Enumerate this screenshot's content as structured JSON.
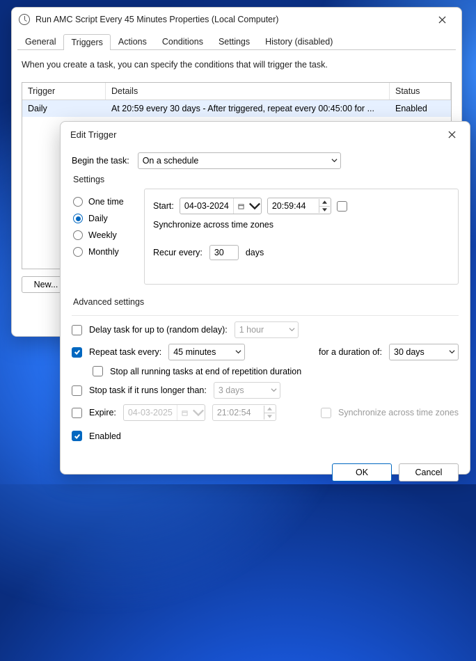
{
  "props": {
    "title": "Run AMC Script Every 45 Minutes Properties (Local Computer)",
    "tabs": [
      "General",
      "Triggers",
      "Actions",
      "Conditions",
      "Settings",
      "History (disabled)"
    ],
    "active_tab": 1,
    "desc": "When you create a task, you can specify the conditions that will trigger the task.",
    "cols": {
      "trigger": "Trigger",
      "details": "Details",
      "status": "Status"
    },
    "row": {
      "trigger": "Daily",
      "details": "At 20:59 every 30 days - After triggered, repeat every 00:45:00 for ...",
      "status": "Enabled"
    },
    "buttons": {
      "new": "New..."
    }
  },
  "edit": {
    "title": "Edit Trigger",
    "begin_label": "Begin the task:",
    "begin_value": "On a schedule",
    "settings_label": "Settings",
    "radios": {
      "onetime": "One time",
      "daily": "Daily",
      "weekly": "Weekly",
      "monthly": "Monthly"
    },
    "start_label": "Start:",
    "start_date": "04-03-2024",
    "start_time": "20:59:44",
    "sync_tz": "Synchronize across time zones",
    "recur_label": "Recur every:",
    "recur_value": "30",
    "recur_unit": "days",
    "adv_label": "Advanced settings",
    "delay_label": "Delay task for up to (random delay):",
    "delay_value": "1 hour",
    "repeat_label": "Repeat task every:",
    "repeat_value": "45 minutes",
    "duration_label": "for a duration of:",
    "duration_value": "30 days",
    "stopall_label": "Stop all running tasks at end of repetition duration",
    "stoplong_label": "Stop task if it runs longer than:",
    "stoplong_value": "3 days",
    "expire_label": "Expire:",
    "expire_date": "04-03-2025",
    "expire_time": "21:02:54",
    "sync_tz2": "Synchronize across time zones",
    "enabled_label": "Enabled",
    "ok": "OK",
    "cancel": "Cancel"
  }
}
